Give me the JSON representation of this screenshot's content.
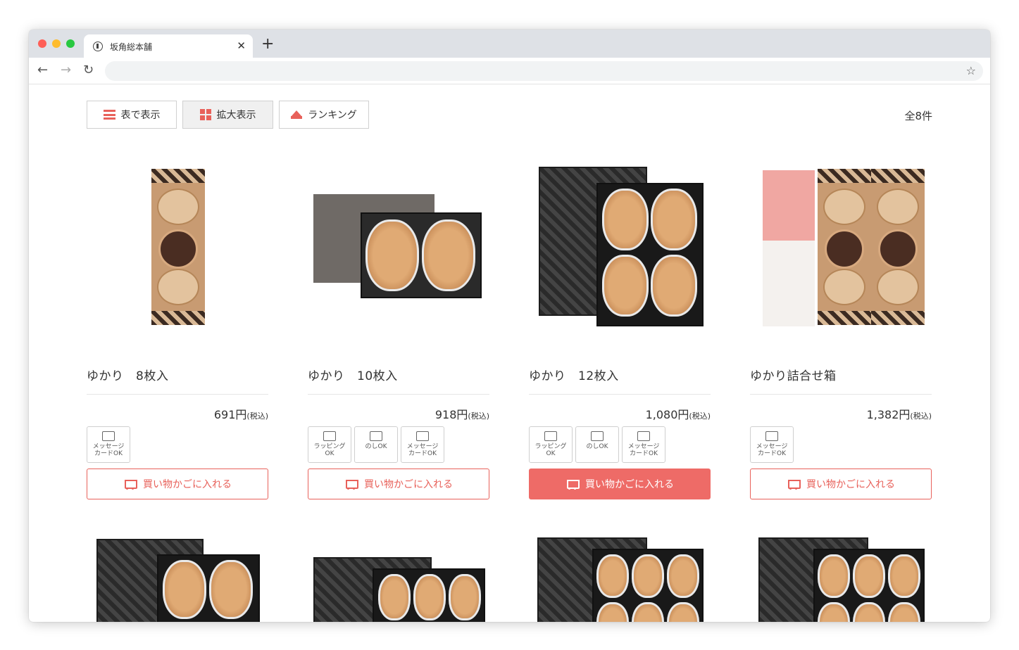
{
  "browser": {
    "tab_title": "坂角総本舗",
    "close_glyph": "✕",
    "newtab_glyph": "+",
    "back_glyph": "←",
    "forward_glyph": "→",
    "reload_glyph": "↻",
    "bookmark_glyph": "☆",
    "url": ""
  },
  "view_buttons": {
    "table_label": "表で表示",
    "large_label": "拡大表示",
    "ranking_label": "ランキング",
    "active": "large"
  },
  "result_count": "全8件",
  "accent_color": "#e8615a",
  "products": [
    {
      "name": "ゆかり　8枚入",
      "price": "691円",
      "tax": "(税込)",
      "badges": [
        {
          "icon": "message-card-icon",
          "line1": "メッセージ",
          "line2": "カードOK"
        }
      ],
      "cart_label": "買い物かごに入れる"
    },
    {
      "name": "ゆかり　10枚入",
      "price": "918円",
      "tax": "(税込)",
      "badges": [
        {
          "icon": "gift-wrap-icon",
          "line1": "ラッピング",
          "line2": "OK"
        },
        {
          "icon": "noshi-icon",
          "line1": "のしOK",
          "line2": ""
        },
        {
          "icon": "message-card-icon",
          "line1": "メッセージ",
          "line2": "カードOK"
        }
      ],
      "cart_label": "買い物かごに入れる"
    },
    {
      "name": "ゆかり　12枚入",
      "price": "1,080円",
      "tax": "(税込)",
      "badges": [
        {
          "icon": "gift-wrap-icon",
          "line1": "ラッピング",
          "line2": "OK"
        },
        {
          "icon": "noshi-icon",
          "line1": "のしOK",
          "line2": ""
        },
        {
          "icon": "message-card-icon",
          "line1": "メッセージ",
          "line2": "カードOK"
        }
      ],
      "cart_label": "買い物かごに入れる"
    },
    {
      "name": "ゆかり詰合せ箱",
      "price": "1,382円",
      "tax": "(税込)",
      "badges": [
        {
          "icon": "message-card-icon",
          "line1": "メッセージ",
          "line2": "カードOK"
        }
      ],
      "cart_label": "買い物かごに入れる"
    }
  ]
}
